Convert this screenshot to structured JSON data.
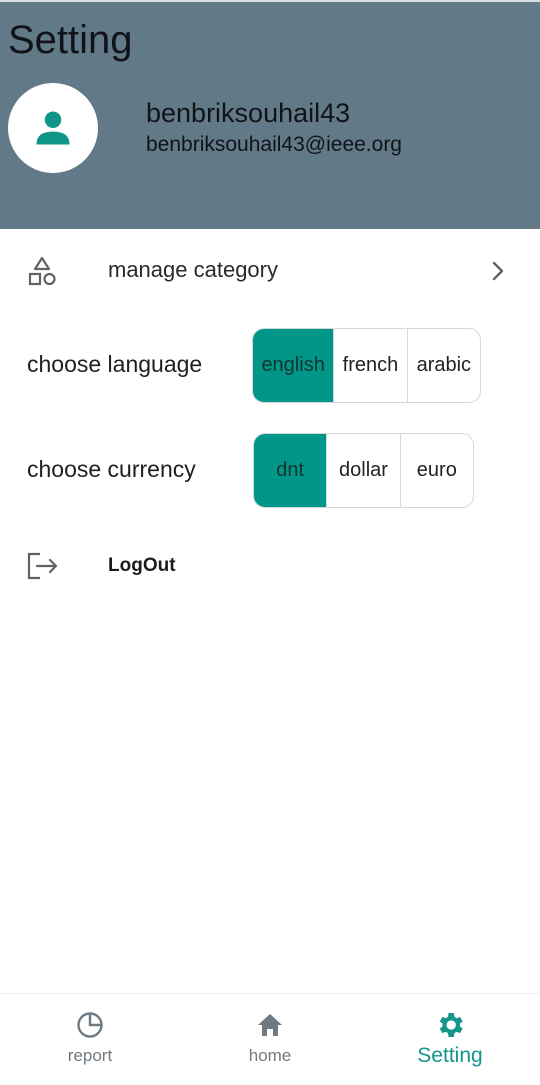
{
  "header": {
    "title": "Setting",
    "username": "benbriksouhail43",
    "email": "benbriksouhail43@ieee.org"
  },
  "menu": {
    "manage_category": "manage category",
    "logout": "LogOut"
  },
  "language": {
    "label": "choose language",
    "options": [
      "english",
      "french",
      "arabic"
    ],
    "selected": "english"
  },
  "currency": {
    "label": "choose currency",
    "options": [
      "dnt",
      "dollar",
      "euro"
    ],
    "selected": "dnt"
  },
  "bottom_nav": {
    "items": [
      {
        "label": "report",
        "icon": "pie-chart-icon"
      },
      {
        "label": "home",
        "icon": "home-icon"
      },
      {
        "label": "Setting",
        "icon": "gear-icon"
      }
    ],
    "active": "Setting"
  },
  "colors": {
    "header_bg": "#627a88",
    "accent": "#009688",
    "active_nav": "#12968a"
  }
}
